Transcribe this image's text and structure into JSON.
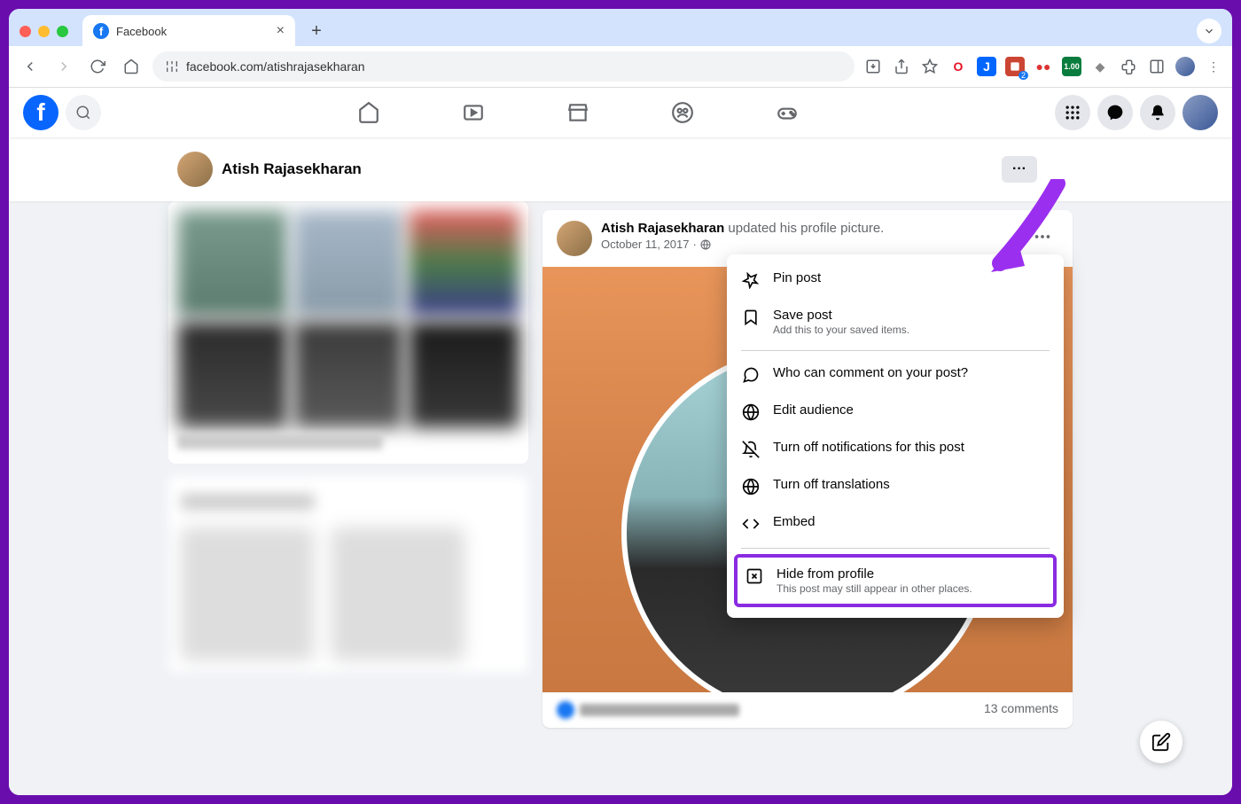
{
  "browser": {
    "tab_title": "Facebook",
    "url": "facebook.com/atishrajasekharan"
  },
  "profile": {
    "name": "Atish Rajasekharan"
  },
  "post": {
    "author": "Atish Rajasekharan",
    "action_text": "updated his profile picture.",
    "date": "October 11, 2017",
    "privacy": "Public",
    "comments_text": "13 comments"
  },
  "menu": {
    "pin": "Pin post",
    "save": "Save post",
    "save_sub": "Add this to your saved items.",
    "who_comment": "Who can comment on your post?",
    "edit_audience": "Edit audience",
    "turn_off_notifications": "Turn off notifications for this post",
    "turn_off_translations": "Turn off translations",
    "embed": "Embed",
    "hide": "Hide from profile",
    "hide_sub": "This post may still appear in other places."
  }
}
